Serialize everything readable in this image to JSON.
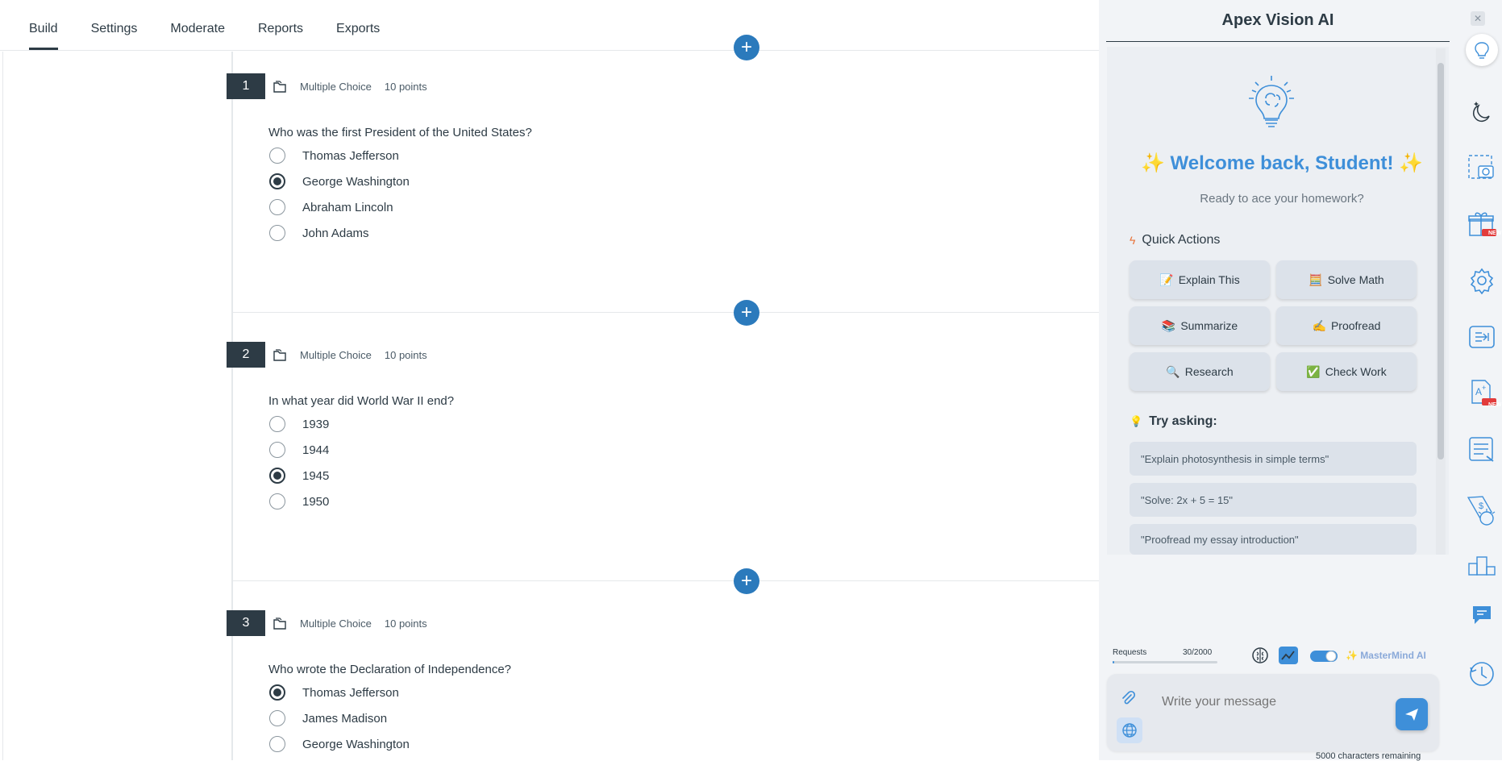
{
  "tabs": [
    {
      "label": "Build",
      "active": true
    },
    {
      "label": "Settings",
      "active": false
    },
    {
      "label": "Moderate",
      "active": false
    },
    {
      "label": "Reports",
      "active": false
    },
    {
      "label": "Exports",
      "active": false
    }
  ],
  "questions": [
    {
      "number": "1",
      "type": "Multiple Choice",
      "points": "10 points",
      "text": "Who was the first President of the United States?",
      "answers": [
        "Thomas Jefferson",
        "George Washington",
        "Abraham Lincoln",
        "John Adams"
      ],
      "selected": 1
    },
    {
      "number": "2",
      "type": "Multiple Choice",
      "points": "10 points",
      "text": "In what year did World War II end?",
      "answers": [
        "1939",
        "1944",
        "1945",
        "1950"
      ],
      "selected": 2
    },
    {
      "number": "3",
      "type": "Multiple Choice",
      "points": "10 points",
      "text": "Who wrote the Declaration of Independence?",
      "answers": [
        "Thomas Jefferson",
        "James Madison",
        "George Washington"
      ],
      "selected": 0
    }
  ],
  "panel": {
    "title": "Apex Vision AI",
    "welcome": "✨ Welcome back, Student! ✨",
    "subtitle": "Ready to ace your homework?",
    "quick_actions_title": "Quick Actions",
    "quick_actions": [
      {
        "icon": "📝",
        "label": "Explain This"
      },
      {
        "icon": "🧮",
        "label": "Solve Math"
      },
      {
        "icon": "📚",
        "label": "Summarize"
      },
      {
        "icon": "✍️",
        "label": "Proofread"
      },
      {
        "icon": "🔍",
        "label": "Research"
      },
      {
        "icon": "✅",
        "label": "Check Work"
      }
    ],
    "try_title": "Try asking:",
    "suggestions": [
      "\"Explain photosynthesis in simple terms\"",
      "\"Solve: 2x + 5 = 15\"",
      "\"Proofread my essay introduction\""
    ],
    "requests_label": "Requests",
    "requests_count": "30/2000",
    "requests_fraction": 0.015,
    "mastermind_label": "✨ MasterMind AI",
    "input_placeholder": "Write your message",
    "chars_remaining": "5000 characters remaining",
    "accent": "#3e8fd9"
  },
  "toolbar_icons": [
    "lightbulb-brain-icon",
    "moon-stars-icon",
    "screenshot-icon",
    "gift-icon",
    "gear-icon",
    "sidebar-collapse-icon",
    "grade-icon",
    "document-lines-icon",
    "pricetag-brain-icon",
    "podium-icon",
    "chat-icon",
    "history-clock-icon"
  ],
  "badges": {
    "new": "NEW"
  }
}
